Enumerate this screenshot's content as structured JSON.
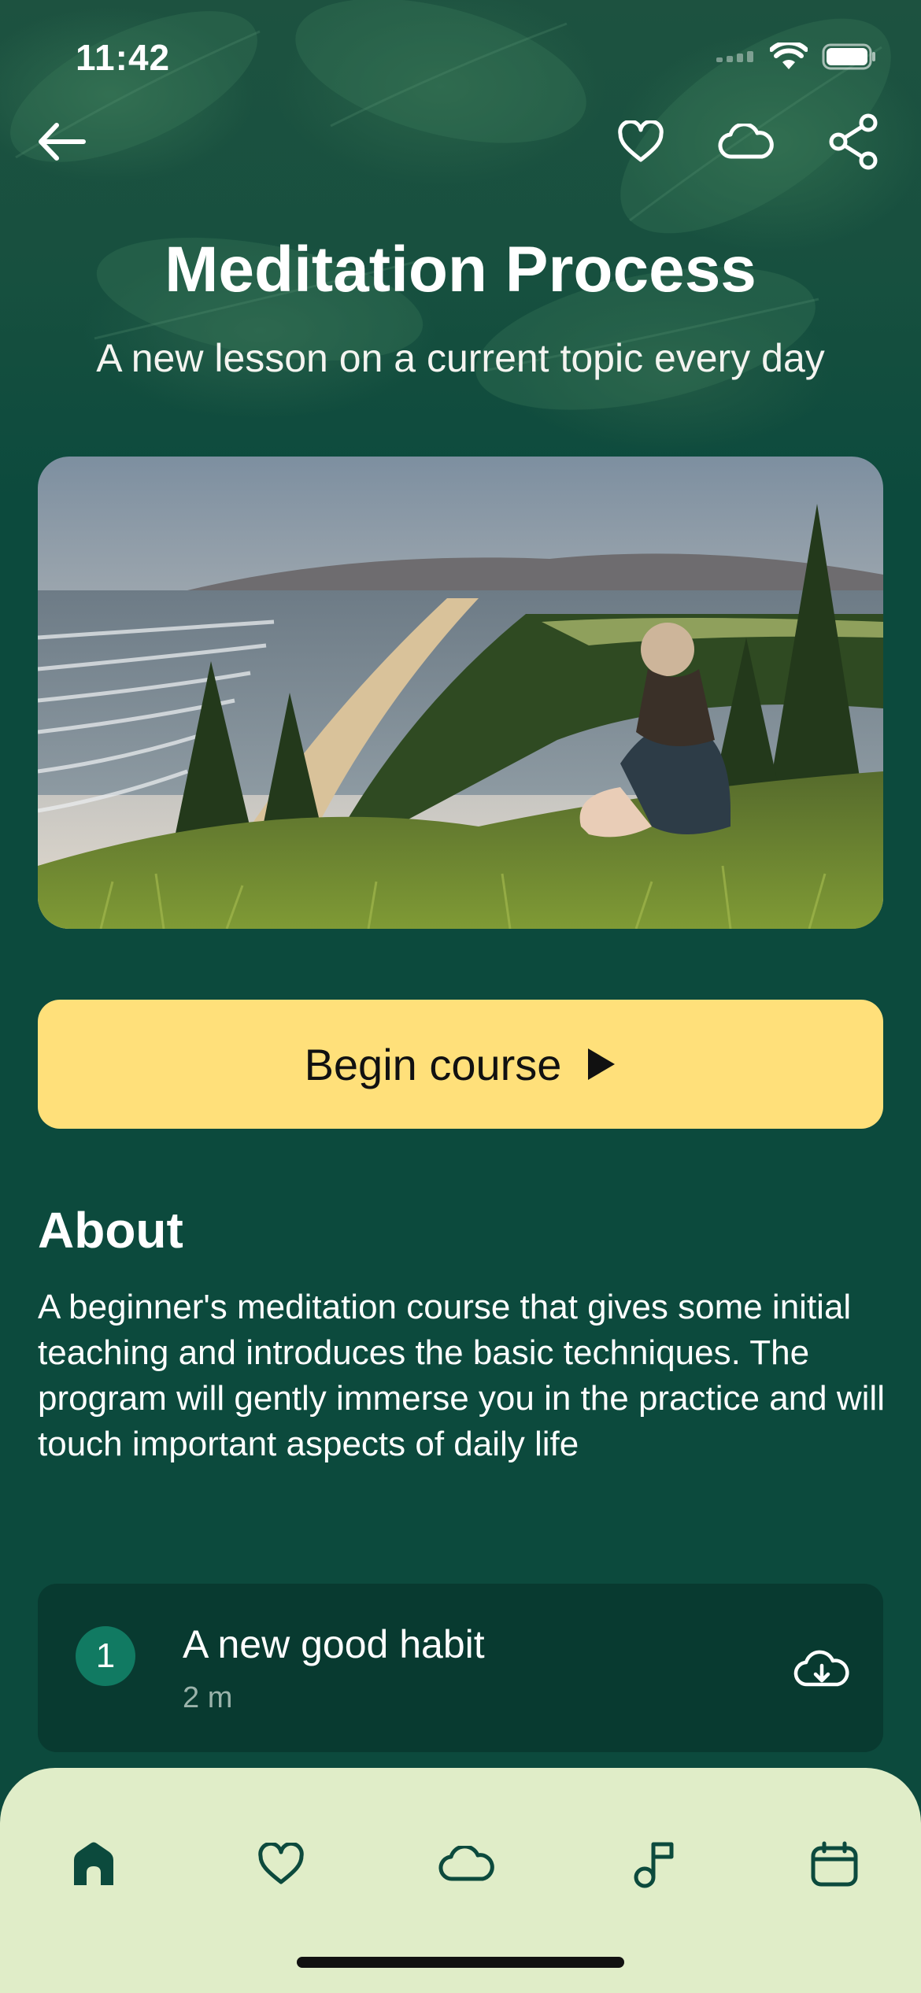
{
  "status_bar": {
    "time": "11:42"
  },
  "header": {
    "back_icon": "arrow-left-icon",
    "actions": [
      "heart-icon",
      "cloud-icon",
      "share-icon"
    ]
  },
  "course": {
    "title": "Meditation Process",
    "subtitle": "A new lesson on a current topic every day"
  },
  "begin_button": {
    "label": "Begin course",
    "icon": "play-icon"
  },
  "about": {
    "heading": "About",
    "text": "A beginner's meditation course that gives some initial teaching and introduces the basic techniques. The program will gently immerse you in the practice and will touch important aspects of daily life"
  },
  "lessons": [
    {
      "number": "1",
      "title": "A new good habit",
      "duration": "2 m",
      "icon": "cloud-download-icon"
    }
  ],
  "tab_bar": {
    "items": [
      "home-icon",
      "heart-icon",
      "cloud-icon",
      "music-note-icon",
      "calendar-icon"
    ],
    "active": "home-icon"
  },
  "colors": {
    "background": "#0c4a3d",
    "button": "#ffe07a",
    "card": "#083a30",
    "badge": "#117a62",
    "tab_bar": "#e0edc8",
    "tab_icon": "#0c4a3d"
  }
}
